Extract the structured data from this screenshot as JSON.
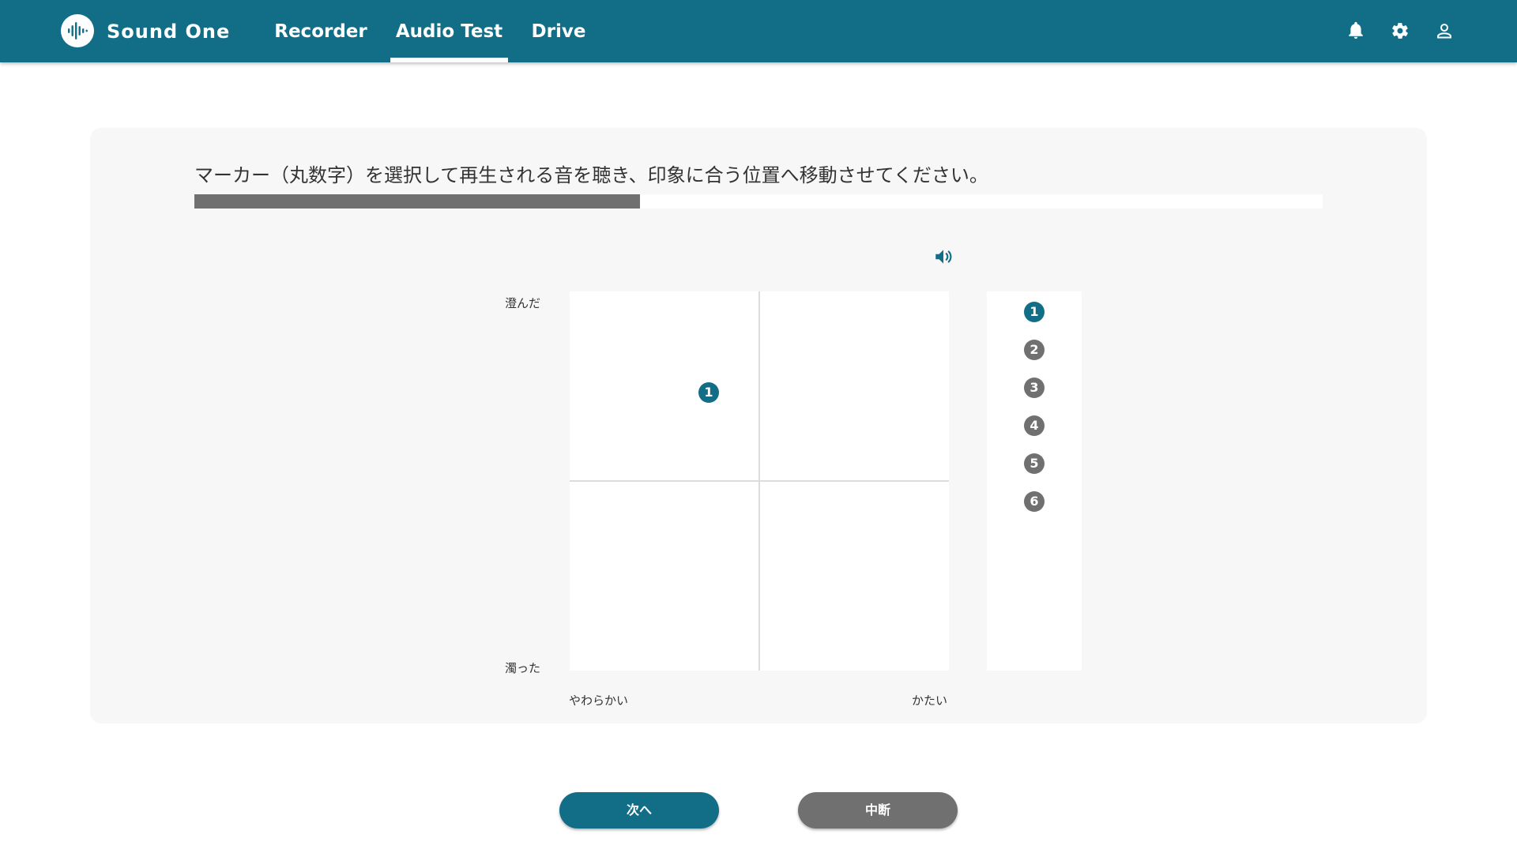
{
  "header": {
    "brand": "Sound One",
    "logo_icon": "waveform-icon",
    "tabs": [
      {
        "label": "Recorder",
        "active": false
      },
      {
        "label": "Audio Test",
        "active": true
      },
      {
        "label": "Drive",
        "active": false
      }
    ],
    "icons": [
      "bell-icon",
      "gear-icon",
      "user-icon"
    ]
  },
  "test": {
    "instruction": "マーカー（丸数字）を選択して再生される音を聴き、印象に合う位置へ移動させてください。",
    "progress_fraction": 0.395,
    "speaker_icon": "speaker-icon",
    "axis": {
      "top": "澄んだ",
      "bottom": "濁った",
      "left": "やわらかい",
      "right": "かたい"
    },
    "placed_marker": {
      "label": "1"
    },
    "markers": [
      {
        "label": "1",
        "selected": true
      },
      {
        "label": "2",
        "selected": false
      },
      {
        "label": "3",
        "selected": false
      },
      {
        "label": "4",
        "selected": false
      },
      {
        "label": "5",
        "selected": false
      },
      {
        "label": "6",
        "selected": false
      }
    ]
  },
  "buttons": {
    "next": "次へ",
    "abort": "中断"
  },
  "colors": {
    "primary": "#126e87",
    "gray": "#707070",
    "panel": "#f7f7f7"
  }
}
